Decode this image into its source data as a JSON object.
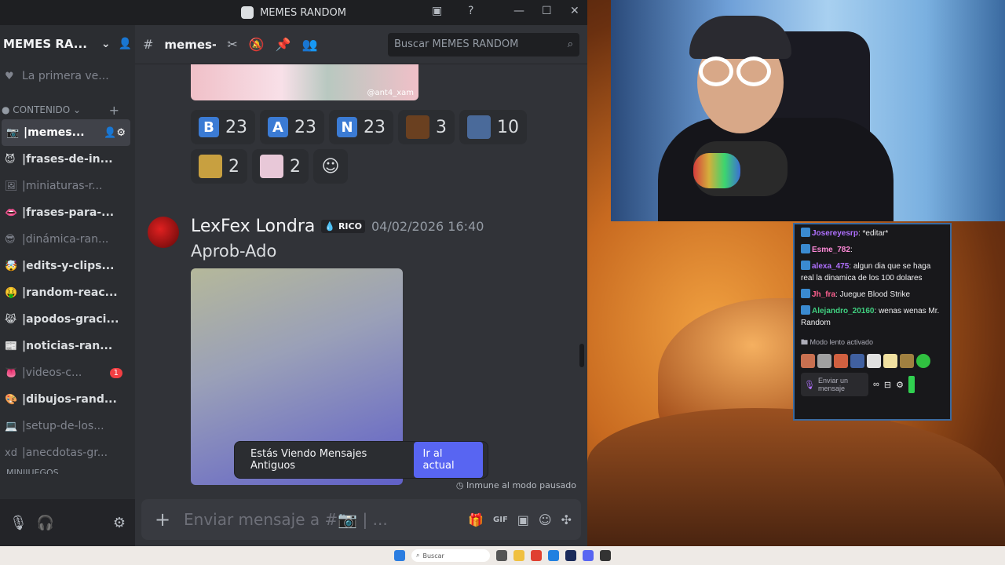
{
  "window": {
    "title": "MEMES RANDOM"
  },
  "server": {
    "name": "MEMES RA..."
  },
  "sidebar": {
    "top_item": "La primera ve...",
    "category": "CONTENIDO",
    "channels": [
      {
        "emoji": "📷",
        "name": "memes...",
        "selected": true
      },
      {
        "emoji": "😈",
        "name": "frases-de-in..."
      },
      {
        "emoji": "🖼",
        "name": "miniaturas-r...",
        "muted": true
      },
      {
        "emoji": "👄",
        "name": "frases-para-..."
      },
      {
        "emoji": "😎",
        "name": "dinámica-ran...",
        "muted": true
      },
      {
        "emoji": "🤯",
        "name": "edits-y-clips..."
      },
      {
        "emoji": "🤑",
        "name": "random-reac..."
      },
      {
        "emoji": "😹",
        "name": "apodos-graci..."
      },
      {
        "emoji": "📰",
        "name": "noticias-ran..."
      },
      {
        "emoji": "👅",
        "name": "videos-c...",
        "muted": true,
        "badge": "1"
      },
      {
        "emoji": "🎨",
        "name": "dibujos-rand..."
      },
      {
        "emoji": "💻",
        "name": "setup-de-los...",
        "muted": true
      },
      {
        "emoji": "xd",
        "name": "anecdotas-gr...",
        "muted": true
      }
    ],
    "next_category": "MINIJUEGOS"
  },
  "channel": {
    "title": "memes-ir",
    "search_placeholder": "Buscar MEMES RANDOM"
  },
  "image_watermark": "@ant4_xam",
  "reactions": [
    {
      "type": "letter",
      "letter": "B",
      "color": "#3b7bd4",
      "count": "23"
    },
    {
      "type": "letter",
      "letter": "A",
      "color": "#3b7bd4",
      "count": "23"
    },
    {
      "type": "letter",
      "letter": "N",
      "color": "#3b7bd4",
      "count": "23"
    },
    {
      "type": "image",
      "color": "#6a4020",
      "count": "3"
    },
    {
      "type": "image",
      "color": "#4a6a9a",
      "count": "10"
    },
    {
      "type": "image",
      "color": "#c8a040",
      "count": "2"
    },
    {
      "type": "image",
      "color": "#e8c8d8",
      "count": "2"
    }
  ],
  "message": {
    "author": "LexFex Londra",
    "role": "RICO",
    "timestamp": "04/02/2026 16:40",
    "text": "Aprob-Ado"
  },
  "old_messages": {
    "text": "Estás Viendo Mensajes Antiguos",
    "button": "Ir al actual"
  },
  "immune_text": "Inmune al modo pausado",
  "composer": {
    "placeholder": "Enviar mensaje a #📷 | ..."
  },
  "twitch_chat": {
    "messages": [
      {
        "user": "Josereyesrp",
        "color": "#b070ff",
        "text": "*editar*"
      },
      {
        "user": "Esme_782",
        "color": "#ff8ad8",
        "text": ""
      },
      {
        "user": "alexa_475",
        "color": "#b070ff",
        "text": "algun dia que se haga real la dinamica de los 100 dolares"
      },
      {
        "user": "Jh_fra",
        "color": "#ff6090",
        "text": "Juegue Blood Strike"
      },
      {
        "user": "Alejandro_20160",
        "color": "#40d080",
        "text": "wenas wenas Mr. Random"
      }
    ],
    "slow_mode": "Modo lento activado",
    "input_placeholder": "Enviar un mensaje"
  },
  "taskbar": {
    "search": "Buscar"
  }
}
